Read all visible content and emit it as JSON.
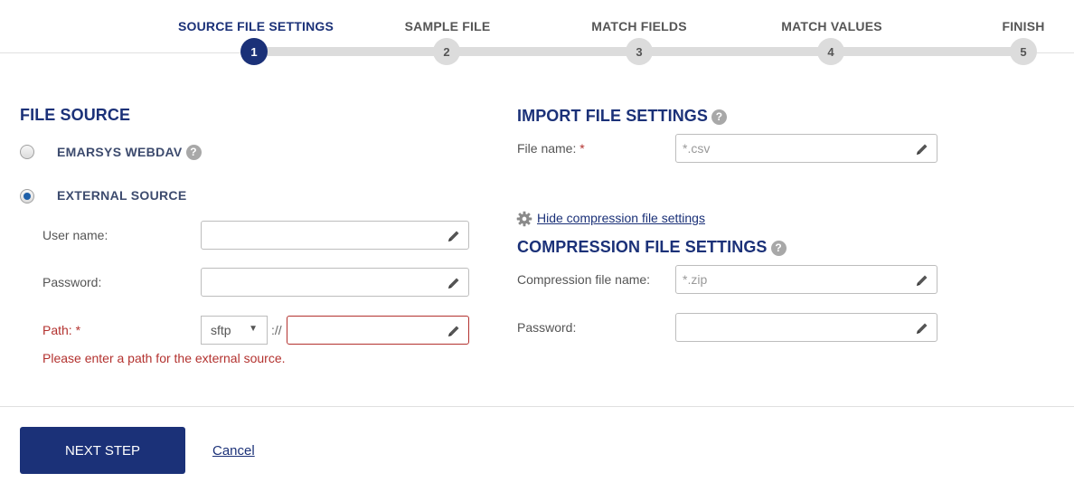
{
  "stepper": {
    "steps": [
      {
        "label": "SOURCE FILE SETTINGS",
        "number": "1",
        "active": true
      },
      {
        "label": "SAMPLE FILE",
        "number": "2",
        "active": false
      },
      {
        "label": "MATCH FIELDS",
        "number": "3",
        "active": false
      },
      {
        "label": "MATCH VALUES",
        "number": "4",
        "active": false
      },
      {
        "label": "FINISH",
        "number": "5",
        "active": false
      }
    ]
  },
  "file_source": {
    "title": "FILE SOURCE",
    "options": [
      {
        "label": "EMARSYS WEBDAV",
        "checked": false
      },
      {
        "label": "EXTERNAL SOURCE",
        "checked": true
      }
    ],
    "username_label": "User name:",
    "username_value": "",
    "password_label": "Password:",
    "password_value": "",
    "path_label": "Path:",
    "required_mark": "*",
    "protocol_value": "sftp",
    "separator": "://",
    "path_value": "",
    "error_message": "Please enter a path for the external source."
  },
  "import_settings": {
    "title": "IMPORT FILE SETTINGS",
    "file_name_label": "File name:",
    "required_mark": "*",
    "file_name_placeholder": "*.csv",
    "toggle_link": "Hide compression file settings"
  },
  "compression": {
    "title": "COMPRESSION FILE SETTINGS",
    "file_name_label": "Compression file name:",
    "file_name_placeholder": "*.zip",
    "password_label": "Password:",
    "password_value": ""
  },
  "footer": {
    "next_label": "NEXT STEP",
    "cancel_label": "Cancel"
  },
  "colors": {
    "primary": "#1b3178",
    "error": "#b3322f",
    "step_inactive": "#dcdcdc"
  },
  "icons": {
    "help": "question-circle",
    "edit": "pencil",
    "settings": "gear",
    "dropdown": "caret-down"
  }
}
